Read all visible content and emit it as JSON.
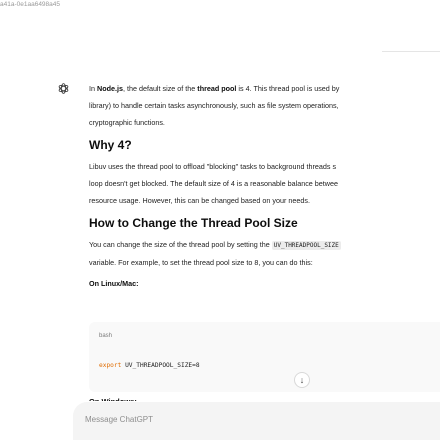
{
  "browser": {
    "url": "a41a-0e1aa6498a45"
  },
  "message": {
    "intro": {
      "p1": "In ",
      "b1": "Node.js",
      "p2": ", the default size of the ",
      "b2": "thread pool",
      "p3": " is 4. This thread pool is used by",
      "line2": "library) to handle certain tasks asynchronously, such as file system operations,",
      "line3": "cryptographic functions."
    },
    "section1": {
      "heading": "Why 4?",
      "line1": "Libuv uses the thread pool to offload \"blocking\" tasks to background threads s",
      "line2": "loop doesn't get blocked. The default size of 4 is a reasonable balance betwee",
      "line3": "resource usage. However, this can be changed based on your needs."
    },
    "section2": {
      "heading": "How to Change the Thread Pool Size",
      "line1_pre": "You can change the size of the thread pool by setting the ",
      "line1_code": "UV_THREADPOOL_SIZE",
      "line2": "variable. For example, to set the thread pool size to 8, you can do this:",
      "subheading": "On Linux/Mac:",
      "next_subheading": "On Windows:"
    },
    "code_block": {
      "language": "bash",
      "keyword": "export",
      "rest": " UV_THREADPOOL_SIZE=8"
    }
  },
  "composer": {
    "placeholder": "Message ChatGPT"
  },
  "icons": {
    "assistant_avatar": "openai-logo-icon",
    "scroll_down": "arrow-down-icon"
  }
}
